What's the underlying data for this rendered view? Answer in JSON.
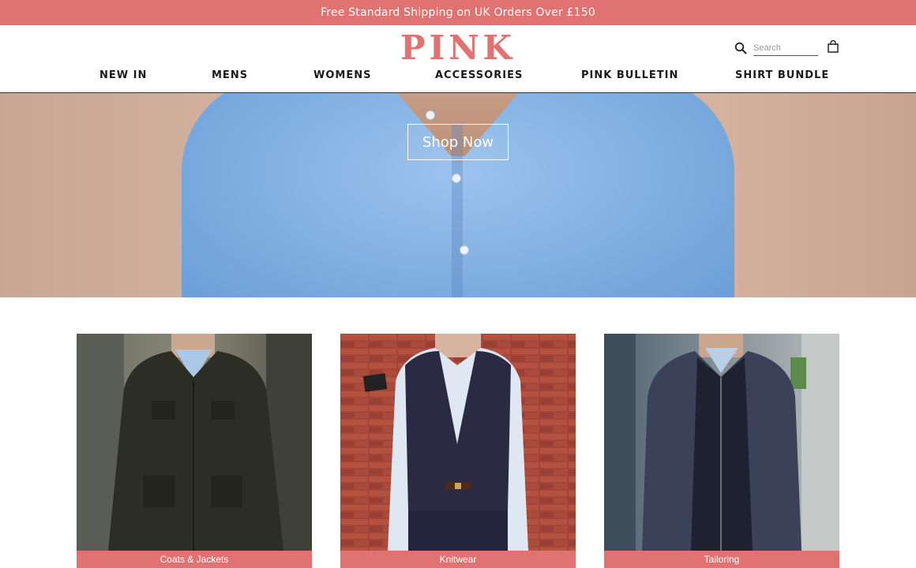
{
  "promo": {
    "text": "Free Standard Shipping on UK Orders Over £150"
  },
  "header": {
    "logo": "PINK",
    "search": {
      "placeholder": "Search",
      "value": ""
    },
    "icons": {
      "search": "search-icon",
      "bag": "shopping-bag-icon"
    }
  },
  "nav": {
    "items": [
      {
        "label": "NEW IN"
      },
      {
        "label": "MENS"
      },
      {
        "label": "WOMENS"
      },
      {
        "label": "ACCESSORIES"
      },
      {
        "label": "PINK BULLETIN"
      },
      {
        "label": "SHIRT BUNDLE"
      }
    ]
  },
  "hero": {
    "cta": "Shop Now"
  },
  "categories": [
    {
      "label": "Coats & Jackets"
    },
    {
      "label": "Knitwear"
    },
    {
      "label": "Tailoring"
    }
  ],
  "colors": {
    "brand": "#e07272",
    "text": "#1a1a1a",
    "background": "#ffffff"
  }
}
